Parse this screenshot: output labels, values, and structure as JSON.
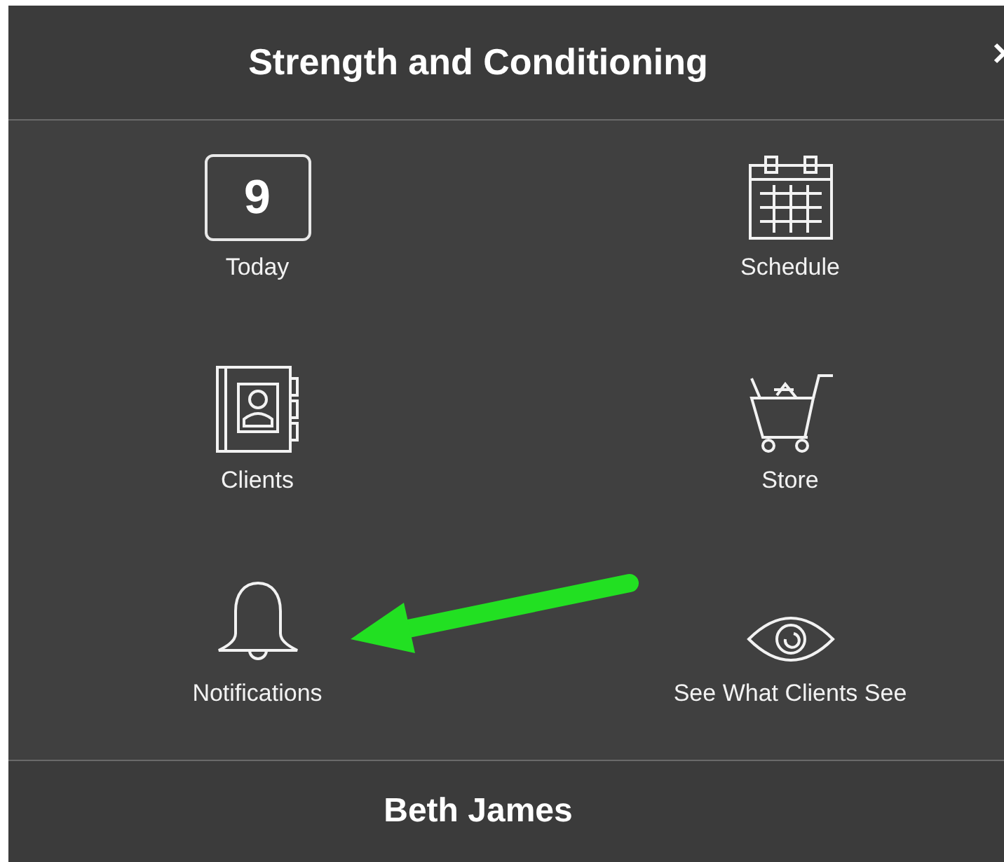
{
  "header": {
    "title": "Strength and Conditioning"
  },
  "tiles": [
    {
      "kind": "date",
      "date": "9",
      "label": "Today"
    },
    {
      "kind": "calendar",
      "label": "Schedule"
    },
    {
      "kind": "contacts",
      "label": "Clients"
    },
    {
      "kind": "cart",
      "label": "Store"
    },
    {
      "kind": "bell",
      "label": "Notifications"
    },
    {
      "kind": "eye",
      "label": "See What Clients See"
    }
  ],
  "footer": {
    "name": "Beth James"
  }
}
